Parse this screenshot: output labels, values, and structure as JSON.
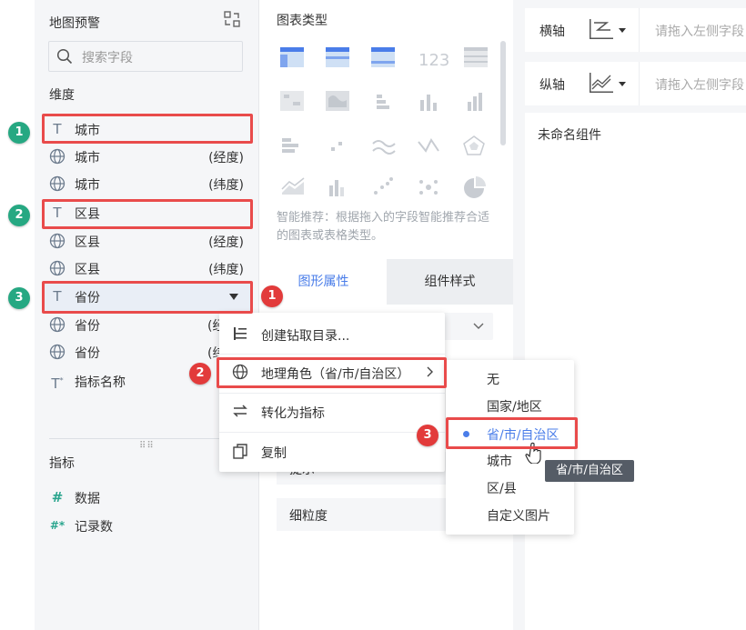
{
  "field_panel": {
    "title": "地图预警",
    "search_placeholder": "搜索字段",
    "dimension_title": "维度",
    "dimensions": [
      {
        "icon": "text-type-icon",
        "name": "城市",
        "sub": ""
      },
      {
        "icon": "globe-icon",
        "name": "城市",
        "sub": "(经度)"
      },
      {
        "icon": "globe-icon",
        "name": "城市",
        "sub": "(纬度)"
      },
      {
        "icon": "text-type-icon",
        "name": "区县",
        "sub": ""
      },
      {
        "icon": "globe-icon",
        "name": "区县",
        "sub": "(经度)"
      },
      {
        "icon": "globe-icon",
        "name": "区县",
        "sub": "(纬度)"
      },
      {
        "icon": "text-type-icon",
        "name": "省份",
        "sub": ""
      },
      {
        "icon": "globe-icon",
        "name": "省份",
        "sub": "(经"
      },
      {
        "icon": "globe-icon",
        "name": "省份",
        "sub": "(纬"
      },
      {
        "icon": "text-type-star-icon",
        "name": "指标名称",
        "sub": ""
      }
    ],
    "measure_title": "指标",
    "measures": [
      {
        "icon": "hash-icon",
        "glyph": "#",
        "name": "数据"
      },
      {
        "icon": "hash-star-icon",
        "glyph": "#*",
        "name": "记录数"
      }
    ]
  },
  "chart_panel": {
    "title": "图表类型",
    "smart_hint": "智能推荐：根据拖入的字段智能推荐合适的图表或表格类型。",
    "tabs": [
      "图形属性",
      "组件样式"
    ],
    "attr_rows": [
      "提示",
      "细粒度"
    ]
  },
  "right_panel": {
    "x_axis_label": "横轴",
    "y_axis_label": "纵轴",
    "axis_placeholder": "请拖入左侧字段",
    "component_title": "未命名组件"
  },
  "context_menu": {
    "items": [
      {
        "icon": "drill-directory-icon",
        "label": "创建钻取目录..."
      },
      {
        "icon": "globe-icon",
        "label": "地理角色（省/市/自治区）"
      },
      {
        "icon": "convert-arrows-icon",
        "label": "转化为指标"
      },
      {
        "icon": "copy-icon",
        "label": "复制"
      }
    ]
  },
  "geo_submenu": {
    "items": [
      "无",
      "国家/地区",
      "省/市/自治区",
      "城市",
      "区/县",
      "自定义图片"
    ],
    "selected": "省/市/自治区"
  },
  "tooltip": "省/市/自治区",
  "badges": {
    "green": [
      "1",
      "2",
      "3"
    ],
    "red": [
      "1",
      "2",
      "3"
    ]
  },
  "colors": {
    "accent": "#4a7de9",
    "highlight_red": "#e94b4b",
    "badge_green": "#26a882",
    "badge_red": "#e23b3b"
  }
}
